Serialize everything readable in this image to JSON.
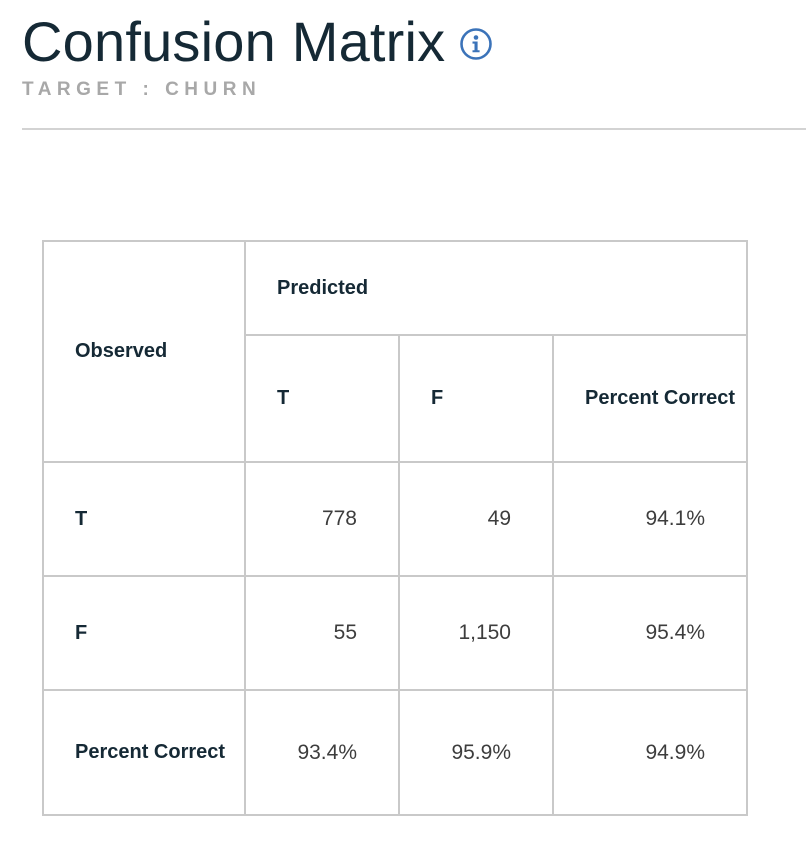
{
  "header": {
    "title": "Confusion Matrix",
    "subtitle": "TARGET : CHURN",
    "info_icon": "info-icon"
  },
  "matrix": {
    "observed_label": "Observed",
    "predicted_label": "Predicted",
    "columns": [
      "T",
      "F",
      "Percent Correct"
    ],
    "rows": [
      {
        "label": "T",
        "values": [
          "778",
          "49",
          "94.1%"
        ]
      },
      {
        "label": "F",
        "values": [
          "55",
          "1,150",
          "95.4%"
        ]
      },
      {
        "label": "Percent Correct",
        "values": [
          "93.4%",
          "95.9%",
          "94.9%"
        ]
      }
    ]
  },
  "colors": {
    "title": "#152935",
    "subtitle": "#a8a8a8",
    "info_icon": "#3b73b9",
    "border": "#c9c9c9"
  }
}
